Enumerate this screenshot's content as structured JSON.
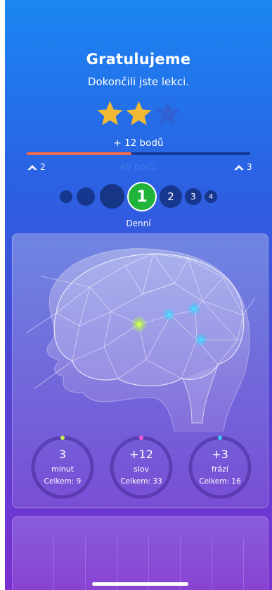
{
  "header": {
    "title": "Gratulujeme",
    "subtitle": "Dokončili jste lekci."
  },
  "rating": {
    "stars_total": 3,
    "stars_earned": 2,
    "star_color": "#f2b935",
    "star_empty_color": "#2f61d4"
  },
  "progress": {
    "points_label": "+ 12 bodů",
    "ghost_label": "49 bodů",
    "fraction": 0.47,
    "fill_color": "#f06a4c",
    "level_current": "2",
    "level_next": "3"
  },
  "streak": {
    "current": "1",
    "upcoming": [
      "2",
      "3",
      "4"
    ],
    "label": "Denní",
    "active_color": "#22b43a"
  },
  "stats": [
    {
      "value": "3",
      "unit": "minut",
      "total": "Celkem: 9",
      "dot_color": "#c6f04a"
    },
    {
      "value": "+12",
      "unit": "slov",
      "total": "Celkem: 33",
      "dot_color": "#f05ad8"
    },
    {
      "value": "+3",
      "unit": "frází",
      "total": "Celkem: 16",
      "dot_color": "#38c6ff"
    }
  ]
}
